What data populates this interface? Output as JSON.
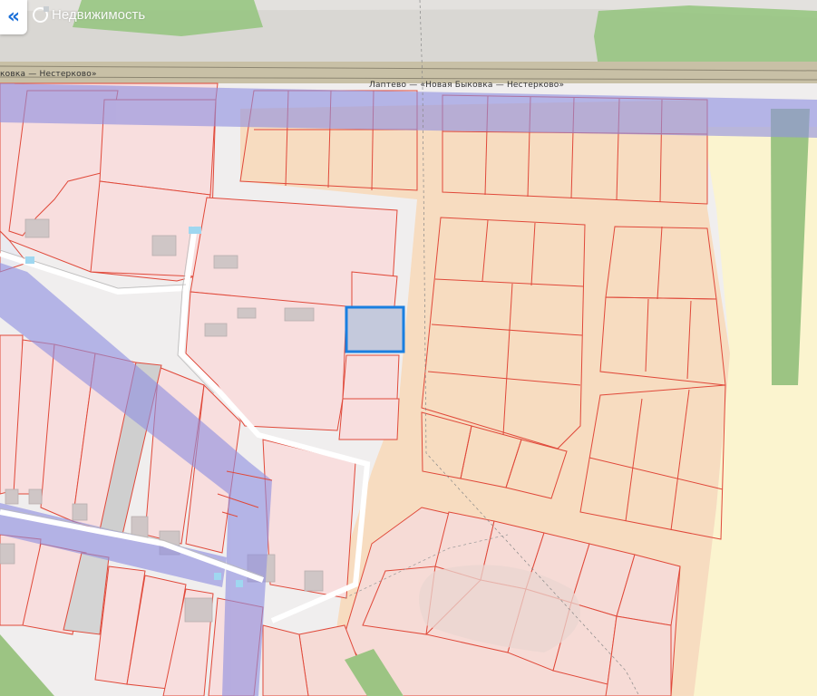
{
  "header": {
    "back_glyph": "«",
    "back_icon": "double-chevron-left-icon",
    "brand_icon": "brand-logo-icon",
    "brand_name": "Недвижимость"
  },
  "map": {
    "road_label_main": "Лаптево — «Новая Быковка — Нестерково»",
    "road_label_left": "ковка — Нестерково»"
  },
  "colors": {
    "accent": "#1a6fd8",
    "parcel_fill": "#f8dede",
    "parcel_border": "#e0493a",
    "zone_fill": "#f7dcc0",
    "corridor_fill": "#9a9ae0",
    "green": "#9cc483",
    "selected_parcel": "#1a7fe0"
  }
}
